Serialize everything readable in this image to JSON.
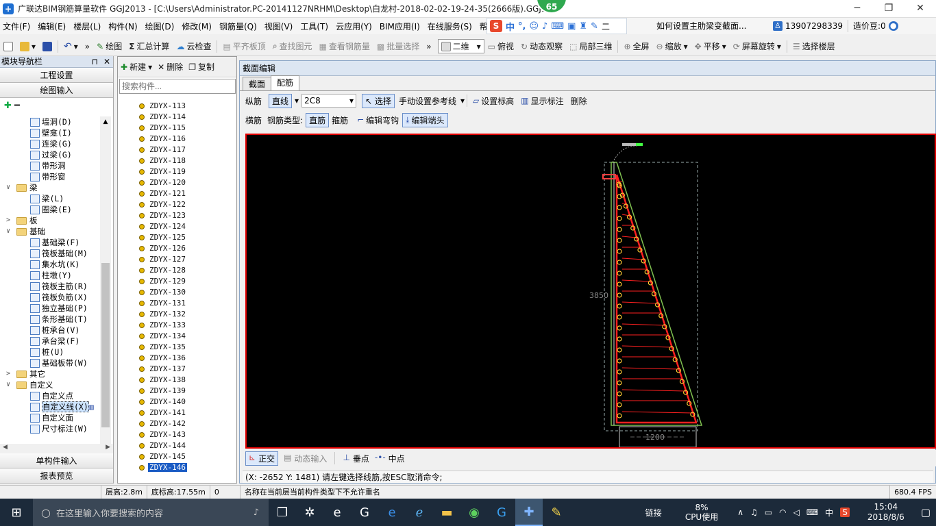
{
  "window": {
    "title": "广联达BIM钢筋算量软件 GGJ2013 - [C:\\Users\\Administrator.PC-20141127NRHM\\Desktop\\白龙村-2018-02-02-19-24-35(2666版).GGJ12",
    "badge": "65",
    "min": "─",
    "max": "❐",
    "close": "✕"
  },
  "menu": [
    "文件(F)",
    "编辑(E)",
    "楼层(L)",
    "构件(N)",
    "绘图(D)",
    "修改(M)",
    "钢筋量(Q)",
    "视图(V)",
    "工具(T)",
    "云应用(Y)",
    "BIM应用(I)",
    "在线服务(S)",
    "帮助(H)"
  ],
  "ime": {
    "logo": "S",
    "lang": "中",
    "extra": "二"
  },
  "menu_right": {
    "hint": "如何设置主肋梁变截面...",
    "phone": "13907298339",
    "beans": "造价豆:0"
  },
  "toolbar": [
    {
      "label": "绘图",
      "icon": "pencil-icon",
      "dis": false
    },
    {
      "label": "汇总计算",
      "icon": "sigma-icon",
      "dis": false
    },
    {
      "label": "云检查",
      "icon": "cloud-check-icon",
      "dis": false
    },
    {
      "label": "平齐板顶",
      "icon": "align-top-icon",
      "dis": true
    },
    {
      "label": "查找图元",
      "icon": "find-icon",
      "dis": true
    },
    {
      "label": "查看钢筋量",
      "icon": "view-rebar-icon",
      "dis": true
    },
    {
      "label": "批量选择",
      "icon": "batch-select-icon",
      "dis": true
    }
  ],
  "toolbar2": {
    "view_mode": "二维",
    "items": [
      "俯视",
      "动态观察",
      "局部三维",
      "全屏",
      "缩放",
      "平移",
      "屏幕旋转",
      "选择楼层"
    ]
  },
  "nav": {
    "title": "模块导航栏",
    "pin": "⊓",
    "close": "✕",
    "top_sections": [
      "工程设置",
      "绘图输入"
    ],
    "tree": [
      {
        "label": "墙洞(D)",
        "level": 2,
        "type": "item"
      },
      {
        "label": "壁龛(I)",
        "level": 2,
        "type": "item"
      },
      {
        "label": "连梁(G)",
        "level": 2,
        "type": "item"
      },
      {
        "label": "过梁(G)",
        "level": 2,
        "type": "item"
      },
      {
        "label": "带形洞",
        "level": 2,
        "type": "item"
      },
      {
        "label": "带形窗",
        "level": 2,
        "type": "item"
      },
      {
        "label": "梁",
        "level": 1,
        "type": "folder",
        "exp": "∨"
      },
      {
        "label": "梁(L)",
        "level": 2,
        "type": "item"
      },
      {
        "label": "圈梁(E)",
        "level": 2,
        "type": "item"
      },
      {
        "label": "板",
        "level": 1,
        "type": "folder",
        "exp": ">"
      },
      {
        "label": "基础",
        "level": 1,
        "type": "folder",
        "exp": "∨"
      },
      {
        "label": "基础梁(F)",
        "level": 2,
        "type": "item"
      },
      {
        "label": "筏板基础(M)",
        "level": 2,
        "type": "item"
      },
      {
        "label": "集水坑(K)",
        "level": 2,
        "type": "item"
      },
      {
        "label": "柱墩(Y)",
        "level": 2,
        "type": "item"
      },
      {
        "label": "筏板主筋(R)",
        "level": 2,
        "type": "item"
      },
      {
        "label": "筏板负筋(X)",
        "level": 2,
        "type": "item"
      },
      {
        "label": "独立基础(P)",
        "level": 2,
        "type": "item"
      },
      {
        "label": "条形基础(T)",
        "level": 2,
        "type": "item"
      },
      {
        "label": "桩承台(V)",
        "level": 2,
        "type": "item"
      },
      {
        "label": "承台梁(F)",
        "level": 2,
        "type": "item"
      },
      {
        "label": "桩(U)",
        "level": 2,
        "type": "item"
      },
      {
        "label": "基础板带(W)",
        "level": 2,
        "type": "item"
      },
      {
        "label": "其它",
        "level": 1,
        "type": "folder",
        "exp": ">"
      },
      {
        "label": "自定义",
        "level": 1,
        "type": "folder",
        "exp": "∨"
      },
      {
        "label": "自定义点",
        "level": 2,
        "type": "item"
      },
      {
        "label": "自定义线(X)",
        "level": 2,
        "type": "item",
        "sel": true
      },
      {
        "label": "自定义面",
        "level": 2,
        "type": "item"
      },
      {
        "label": "尺寸标注(W)",
        "level": 2,
        "type": "item"
      }
    ],
    "bottom_sections": [
      "单构件输入",
      "报表预览"
    ]
  },
  "components": {
    "new_label": "新建",
    "delete_label": "删除",
    "copy_label": "复制",
    "search_placeholder": "搜索构件...",
    "items": [
      "ZDYX-113",
      "ZDYX-114",
      "ZDYX-115",
      "ZDYX-116",
      "ZDYX-117",
      "ZDYX-118",
      "ZDYX-119",
      "ZDYX-120",
      "ZDYX-121",
      "ZDYX-122",
      "ZDYX-123",
      "ZDYX-124",
      "ZDYX-125",
      "ZDYX-126",
      "ZDYX-127",
      "ZDYX-128",
      "ZDYX-129",
      "ZDYX-130",
      "ZDYX-131",
      "ZDYX-132",
      "ZDYX-133",
      "ZDYX-134",
      "ZDYX-135",
      "ZDYX-136",
      "ZDYX-137",
      "ZDYX-138",
      "ZDYX-139",
      "ZDYX-140",
      "ZDYX-141",
      "ZDYX-142",
      "ZDYX-143",
      "ZDYX-144",
      "ZDYX-145",
      "ZDYX-146"
    ],
    "selected": "ZDYX-146"
  },
  "editor": {
    "title": "截面编辑",
    "tabs": [
      "截面",
      "配筋"
    ],
    "active_tab": "配筋",
    "row1": {
      "longitudinal": "纵筋",
      "line_mode": "直线",
      "rebar_spec": "2C8",
      "select": "选择",
      "manual_ref": "手动设置参考线",
      "set_elev": "设置标高",
      "show_annot": "显示标注",
      "delete": "删除"
    },
    "row2": {
      "transverse": "横筋",
      "rebar_type_label": "钢筋类型:",
      "straight": "直筋",
      "stirrup": "箍筋",
      "edit_bend": "编辑弯钩",
      "edit_end": "编辑端头"
    },
    "canvas": {
      "dim_height": "3850",
      "dim_width": "1200",
      "bg": "#000000",
      "rebar_color": "#ff2020",
      "node_color": "#ffcc33",
      "outline_color": "#7fc050"
    },
    "snap": [
      "正交",
      "动态输入",
      "垂点",
      "中点"
    ],
    "command": "(X: -2652 Y: 1481)  请左键选择线筋,按ESC取消命令;"
  },
  "status": {
    "floor_height": "层高:2.8m",
    "base_elev": "底标高:17.55m",
    "zero": "0",
    "message": "名称在当前层当前构件类型下不允许重名",
    "fps": "680.4 FPS"
  },
  "taskbar": {
    "search_placeholder": "在这里输入你要搜索的内容",
    "link_label": "链接",
    "cpu_pct": "8%",
    "cpu_label": "CPU使用",
    "ime": "中",
    "time": "15:04",
    "date": "2018/8/6"
  }
}
